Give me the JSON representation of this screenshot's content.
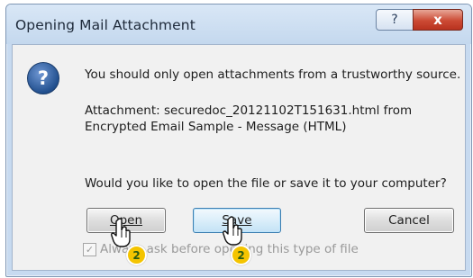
{
  "window": {
    "title": "Opening Mail Attachment"
  },
  "titlebar": {
    "help_glyph": "?",
    "close_glyph": "x"
  },
  "dialog": {
    "icon": "question-icon",
    "icon_glyph": "?",
    "warning": "You should only open attachments from a trustworthy source.",
    "attachment_line1": "Attachment: securedoc_20121102T151631.html from",
    "attachment_line2": "Encrypted Email Sample - Message (HTML)",
    "question": "Would you like to open the file or save it to your computer?"
  },
  "buttons": {
    "open": "Open",
    "save": "Save",
    "cancel": "Cancel"
  },
  "checkbox": {
    "label": "Always ask before opening this type of file",
    "checked": true,
    "check_glyph": "✓"
  },
  "annotations": {
    "step_label": "2"
  }
}
